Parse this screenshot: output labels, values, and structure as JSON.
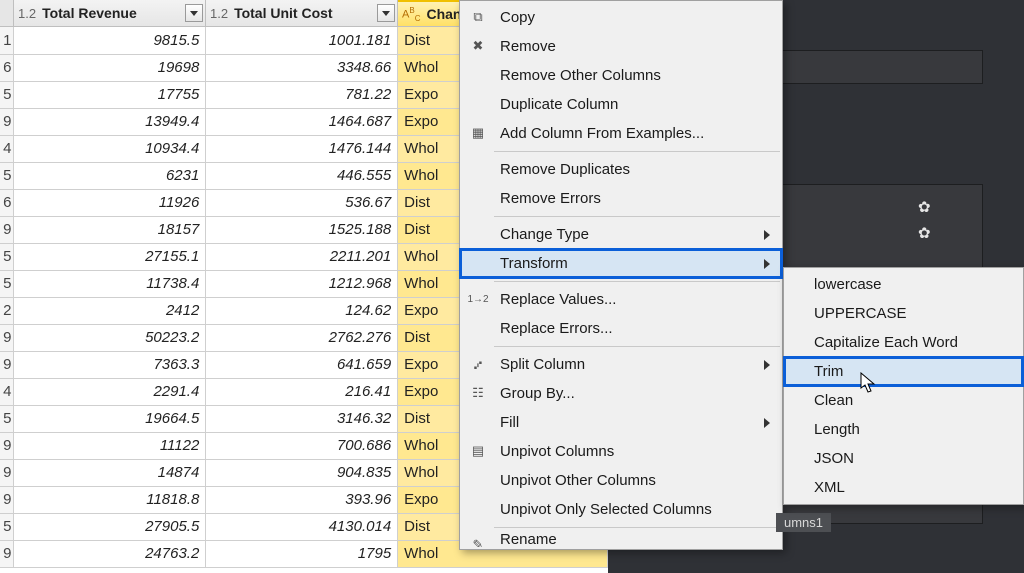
{
  "columns": {
    "revenue": {
      "type": "1.2",
      "label": "Total Revenue"
    },
    "cost": {
      "type": "1.2",
      "label": "Total Unit Cost"
    },
    "channel": {
      "type": "ABC",
      "label": "Chan"
    }
  },
  "rows": [
    {
      "idx": "1",
      "rev": "9815.5",
      "cost": "1001.181",
      "ch": "Dist"
    },
    {
      "idx": "6",
      "rev": "19698",
      "cost": "3348.66",
      "ch": "Whol"
    },
    {
      "idx": "5",
      "rev": "17755",
      "cost": "781.22",
      "ch": "Expo"
    },
    {
      "idx": "9",
      "rev": "13949.4",
      "cost": "1464.687",
      "ch": "Expo"
    },
    {
      "idx": "4",
      "rev": "10934.4",
      "cost": "1476.144",
      "ch": "Whol"
    },
    {
      "idx": "5",
      "rev": "6231",
      "cost": "446.555",
      "ch": "Whol"
    },
    {
      "idx": "6",
      "rev": "11926",
      "cost": "536.67",
      "ch": "Dist"
    },
    {
      "idx": "9",
      "rev": "18157",
      "cost": "1525.188",
      "ch": "Dist"
    },
    {
      "idx": "5",
      "rev": "27155.1",
      "cost": "2211.201",
      "ch": "Whol"
    },
    {
      "idx": "5",
      "rev": "11738.4",
      "cost": "1212.968",
      "ch": "Whol"
    },
    {
      "idx": "2",
      "rev": "2412",
      "cost": "124.62",
      "ch": "Expo"
    },
    {
      "idx": "9",
      "rev": "50223.2",
      "cost": "2762.276",
      "ch": "Dist"
    },
    {
      "idx": "9",
      "rev": "7363.3",
      "cost": "641.659",
      "ch": "Expo"
    },
    {
      "idx": "4",
      "rev": "2291.4",
      "cost": "216.41",
      "ch": "Expo"
    },
    {
      "idx": "5",
      "rev": "19664.5",
      "cost": "3146.32",
      "ch": "Dist"
    },
    {
      "idx": "9",
      "rev": "11122",
      "cost": "700.686",
      "ch": "Whol"
    },
    {
      "idx": "9",
      "rev": "14874",
      "cost": "904.835",
      "ch": "Whol"
    },
    {
      "idx": "9",
      "rev": "11818.8",
      "cost": "393.96",
      "ch": "Expo"
    },
    {
      "idx": "5",
      "rev": "27905.5",
      "cost": "4130.014",
      "ch": "Dist"
    },
    {
      "idx": "9",
      "rev": "24763.2",
      "cost": "1795",
      "ch": "Whol"
    }
  ],
  "context_menu": {
    "copy": "Copy",
    "remove": "Remove",
    "remove_other": "Remove Other Columns",
    "duplicate": "Duplicate Column",
    "add_from_examples": "Add Column From Examples...",
    "remove_duplicates": "Remove Duplicates",
    "remove_errors": "Remove Errors",
    "change_type": "Change Type",
    "transform": "Transform",
    "replace_values": "Replace Values...",
    "replace_errors": "Replace Errors...",
    "split_column": "Split Column",
    "group_by": "Group By...",
    "fill": "Fill",
    "unpivot": "Unpivot Columns",
    "unpivot_other": "Unpivot Other Columns",
    "unpivot_selected": "Unpivot Only Selected Columns",
    "rename": "Rename"
  },
  "submenu": {
    "lowercase": "lowercase",
    "uppercase": "UPPERCASE",
    "capitalize": "Capitalize Each Word",
    "trim": "Trim",
    "clean": "Clean",
    "length": "Length",
    "json": "JSON",
    "xml": "XML"
  },
  "side": {
    "tab": "umns1"
  }
}
